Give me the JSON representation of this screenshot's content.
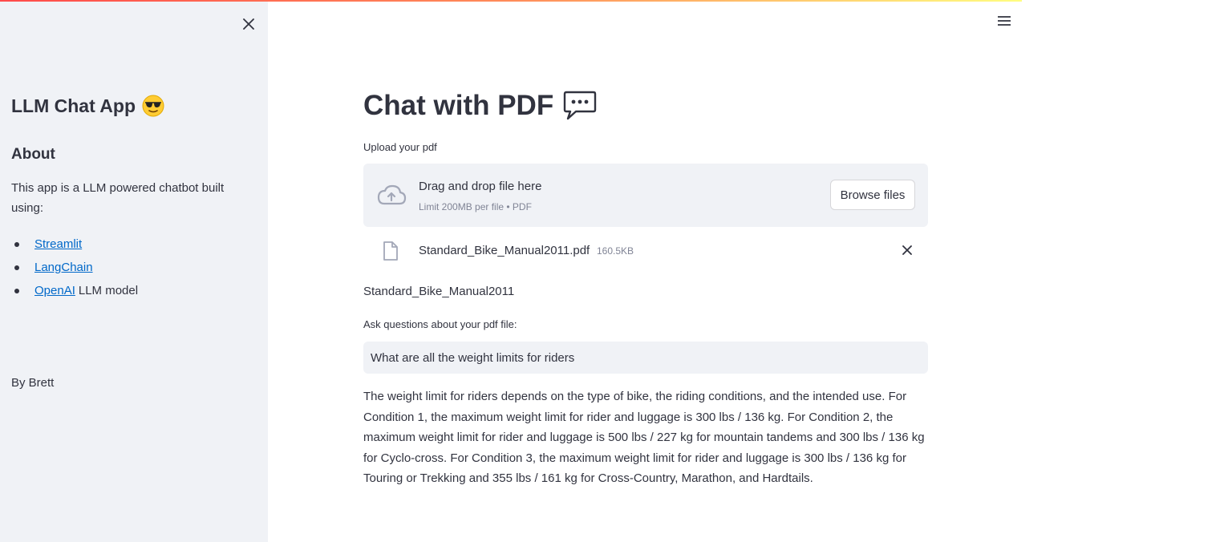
{
  "colors": {
    "sidebar_bg": "#f0f2f6",
    "text": "#31333f",
    "link": "#0068c9",
    "muted": "#808495",
    "input_bg": "#f0f2f6",
    "topbar_gradient": [
      "#ff4b4b",
      "#fffd80"
    ]
  },
  "sidebar": {
    "close_icon": "close-icon",
    "title": "LLM Chat App",
    "title_emoji": "sunglasses-emoji",
    "about_heading": "About",
    "description": "This app is a LLM powered chatbot built using:",
    "items": [
      {
        "link": "Streamlit",
        "suffix": ""
      },
      {
        "link": "LangChain",
        "suffix": ""
      },
      {
        "link": "OpenAI",
        "suffix": "LLM model"
      }
    ],
    "byline": "By Brett"
  },
  "header": {
    "menu_icon": "hamburger-menu-icon"
  },
  "main": {
    "title": "Chat with PDF",
    "title_emoji": "speech-bubble-emoji",
    "upload_label": "Upload your pdf",
    "uploader": {
      "icon": "cloud-upload-icon",
      "drag_text": "Drag and drop file here",
      "limit_text": "Limit 200MB per file • PDF",
      "browse_label": "Browse files"
    },
    "file": {
      "icon": "file-icon",
      "name": "Standard_Bike_Manual2011.pdf",
      "size": "160.5KB",
      "remove_icon": "close-icon"
    },
    "doc_name": "Standard_Bike_Manual2011",
    "question_label": "Ask questions about your pdf file:",
    "question_value": "What are all the weight limits for riders",
    "answer": "The weight limit for riders depends on the type of bike, the riding conditions, and the intended use. For Condition 1, the maximum weight limit for rider and luggage is 300 lbs / 136 kg. For Condition 2, the maximum weight limit for rider and luggage is 500 lbs / 227 kg for mountain tandems and 300 lbs / 136 kg for Cyclo-cross. For Condition 3, the maximum weight limit for rider and luggage is 300 lbs / 136 kg for Touring or Trekking and 355 lbs / 161 kg for Cross-Country, Marathon, and Hardtails."
  }
}
